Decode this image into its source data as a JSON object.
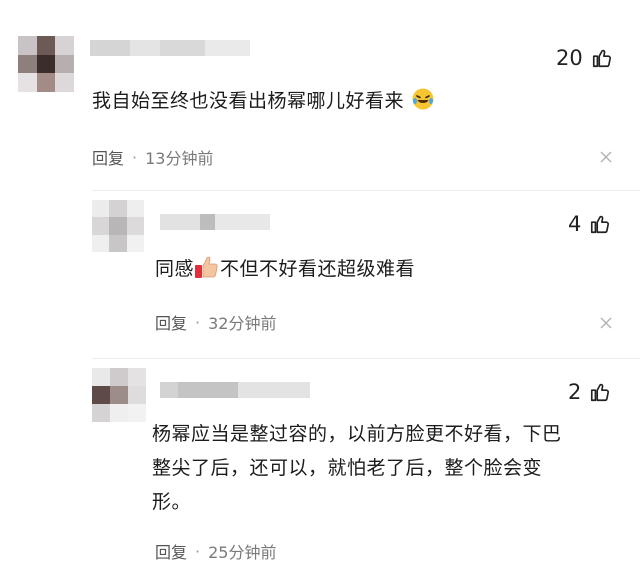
{
  "comments": [
    {
      "likes": "20",
      "text": "我自始至终也没看出杨幂哪儿好看来",
      "emoji": "laughing-crying-emoji",
      "reply": "回复",
      "sep": "·",
      "time": "13分钟前"
    },
    {
      "likes": "4",
      "text_before": "同感",
      "emoji": "thumbs-up-emoji",
      "text_after": "不但不好看还超级难看",
      "reply": "回复",
      "sep": "·",
      "time": "32分钟前"
    },
    {
      "likes": "2",
      "text_line1": "杨幂应当是整过容的，以前方脸更不好看，下巴",
      "text_line2": "整尖了后，还可以，就怕老了后，整个脸会变",
      "text_line3": "形。",
      "reply": "回复",
      "sep": "·",
      "time": "25分钟前"
    }
  ],
  "colors": {
    "text": "#1c1c1c",
    "meta": "#7a7a7a",
    "background": "#ffffff"
  }
}
